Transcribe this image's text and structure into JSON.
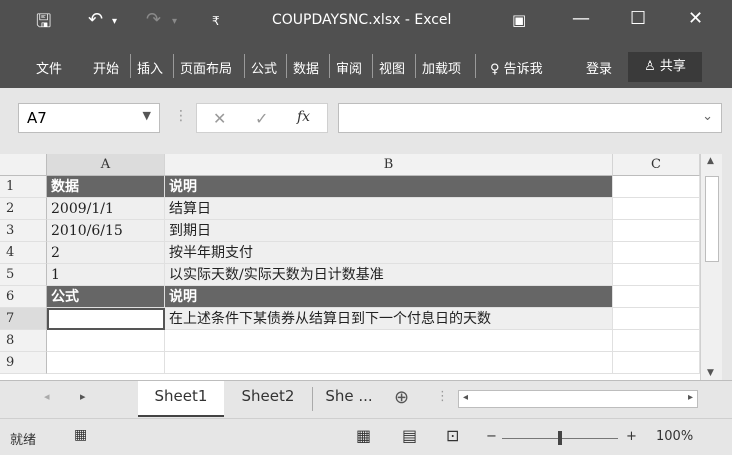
{
  "window": {
    "title": "COUPDAYSNC.xlsx - Excel"
  },
  "ribbon": {
    "tabs": [
      "文件",
      "开始",
      "插入",
      "页面布局",
      "公式",
      "数据",
      "审阅",
      "视图",
      "加载项"
    ],
    "tell_me": "告诉我",
    "login": "登录",
    "share": "共享"
  },
  "formula_bar": {
    "name_box": "A7",
    "fx": "fx",
    "value": ""
  },
  "columns": [
    "A",
    "B",
    "C"
  ],
  "rows": [
    {
      "num": "1",
      "a": "数据",
      "b": "说明",
      "style": "header"
    },
    {
      "num": "2",
      "a": "2009/1/1",
      "b": "结算日",
      "style": "shaded"
    },
    {
      "num": "3",
      "a": "2010/6/15",
      "b": "到期日",
      "style": "shaded"
    },
    {
      "num": "4",
      "a": "2",
      "b": "按半年期支付",
      "style": "shaded"
    },
    {
      "num": "5",
      "a": "1",
      "b": "以实际天数/实际天数为日计数基准",
      "style": "shaded"
    },
    {
      "num": "6",
      "a": "公式",
      "b": "说明",
      "style": "header"
    },
    {
      "num": "7",
      "a": "",
      "b": "在上述条件下某债券从结算日到下一个付息日的天数",
      "style": "shaded"
    },
    {
      "num": "8",
      "a": "",
      "b": "",
      "style": "plain"
    },
    {
      "num": "9",
      "a": "",
      "b": "",
      "style": "plain"
    }
  ],
  "sheets": {
    "tabs": [
      "Sheet1",
      "Sheet2",
      "She ..."
    ],
    "active": "Sheet1"
  },
  "status": {
    "mode": "就绪",
    "zoom": "100%"
  },
  "colors": {
    "title_bar": "#505050",
    "header_row": "#666666",
    "shaded_row": "#efefef"
  }
}
